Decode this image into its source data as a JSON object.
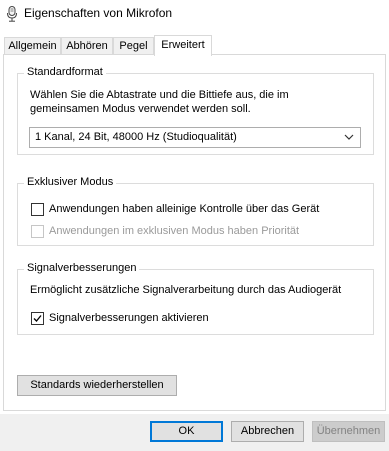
{
  "window": {
    "title": "Eigenschaften von Mikrofon"
  },
  "tabs": [
    {
      "label": "Allgemein"
    },
    {
      "label": "Abhören"
    },
    {
      "label": "Pegel"
    },
    {
      "label": "Erweitert"
    }
  ],
  "active_tab": "Erweitert",
  "standardformat": {
    "title": "Standardformat",
    "description_line1": "Wählen Sie die Abtastrate und die Bittiefe aus, die im",
    "description_line2": "gemeinsamen Modus verwendet werden soll.",
    "selected_format": "1 Kanal, 24 Bit, 48000 Hz (Studioqualität)"
  },
  "exklusiv": {
    "title": "Exklusiver Modus",
    "option1": {
      "label": "Anwendungen haben alleinige Kontrolle über das Gerät",
      "checked": false,
      "enabled": true
    },
    "option2": {
      "label": "Anwendungen im exklusiven Modus haben Priorität",
      "checked": false,
      "enabled": false
    }
  },
  "signal": {
    "title": "Signalverbesserungen",
    "description": "Ermöglicht zusätzliche Signalverarbeitung durch das Audiogerät",
    "option": {
      "label": "Signalverbesserungen aktivieren",
      "checked": true,
      "enabled": true
    }
  },
  "buttons": {
    "restore_defaults": "Standards wiederherstellen",
    "ok": "OK",
    "cancel": "Abbrechen",
    "apply": "Übernehmen"
  },
  "colors": {
    "accent": "#0078d7",
    "panel_border": "#d9d9d9",
    "footer_bg": "#f0f0f0",
    "disabled_text": "#9a9a9a"
  }
}
